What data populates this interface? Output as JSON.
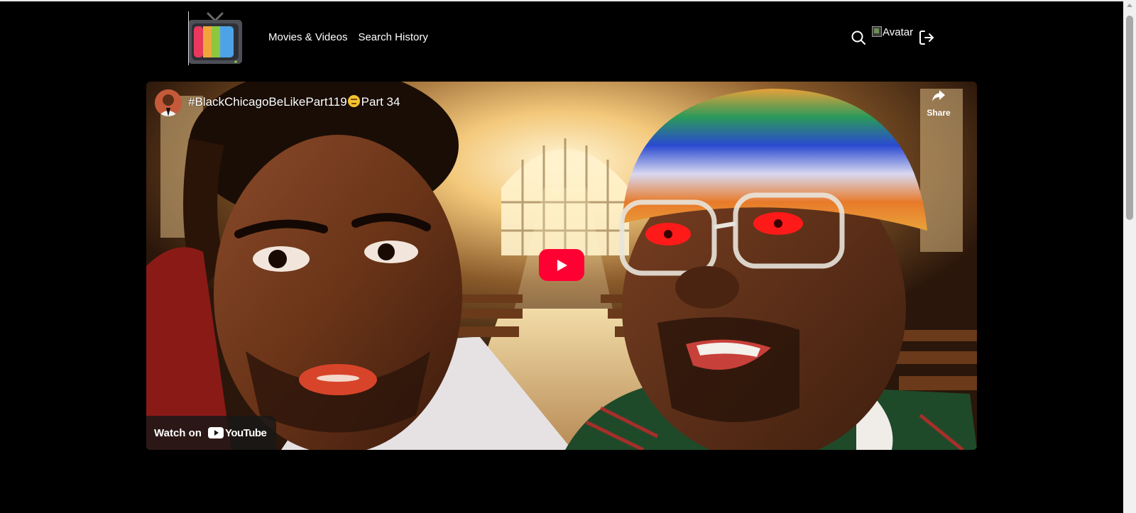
{
  "header": {
    "logo": "retro-tv-logo",
    "nav": [
      {
        "label": "Movies & Videos"
      },
      {
        "label": "Search History"
      }
    ],
    "avatar_alt": "Avatar",
    "icons": [
      "search-icon",
      "logout-icon"
    ]
  },
  "video": {
    "title_prefix": "#BlackChicagoBeLikePart119",
    "title_suffix": "Part 34",
    "share_label": "Share",
    "watch_on_label": "Watch on",
    "youtube_label": "YouTube",
    "play_color": "#ff0033"
  },
  "colors": {
    "background": "#000000",
    "text": "#ffffff"
  }
}
